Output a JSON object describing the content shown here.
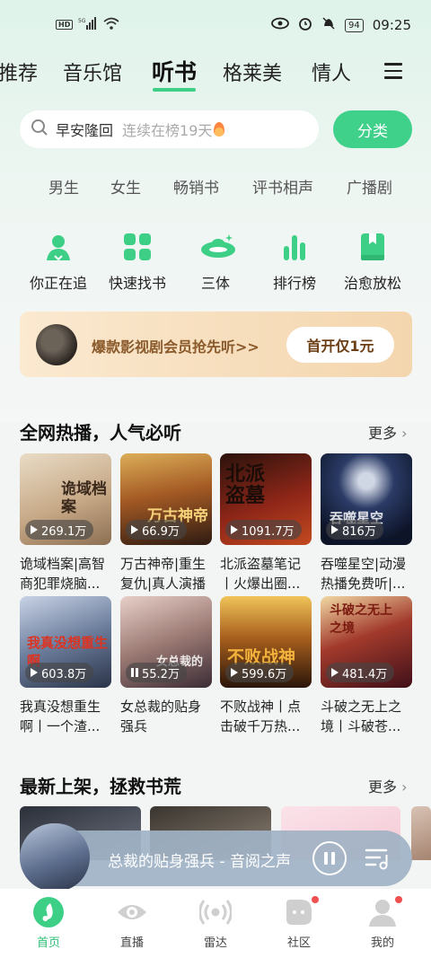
{
  "status_bar": {
    "time": "09:25",
    "battery": "94",
    "hd": "HD",
    "net": "5G"
  },
  "top_tabs": [
    {
      "label": "推荐"
    },
    {
      "label": "音乐馆"
    },
    {
      "label": "听书"
    },
    {
      "label": "格莱美"
    },
    {
      "label": "情人"
    }
  ],
  "search": {
    "keyword": "早安隆回",
    "hint": "连续在榜19天"
  },
  "category_button": "分类",
  "sub_categories": [
    "男生",
    "女生",
    "畅销书",
    "评书相声",
    "广播剧"
  ],
  "quick_entries": [
    {
      "label": "你正在追",
      "icon": "user-listening-icon"
    },
    {
      "label": "快速找书",
      "icon": "grid-icon"
    },
    {
      "label": "三体",
      "icon": "ufo-icon"
    },
    {
      "label": "排行榜",
      "icon": "bar-chart-icon"
    },
    {
      "label": "治愈放松",
      "icon": "book-icon"
    }
  ],
  "banner": {
    "text": "爆款影视剧会员抢先听>>",
    "button": "首开仅1元"
  },
  "section_hot": {
    "title": "全网热播，人气必听",
    "more": "更多",
    "books": [
      {
        "cover_text": "诡域档案",
        "plays": "269.1万",
        "name": "诡域档案|高智商犯罪烧脑..."
      },
      {
        "cover_text": "万古神帝",
        "plays": "66.9万",
        "name": "万古神帝|重生复仇|真人演播"
      },
      {
        "cover_text": "北派盗墓",
        "plays": "1091.7万",
        "name": "北派盗墓笔记丨火爆出圈..."
      },
      {
        "cover_text": "吞噬星空",
        "plays": "816万",
        "name": "吞噬星空|动漫热播免费听|..."
      },
      {
        "cover_text": "我真没想重生啊",
        "plays": "603.8万",
        "name": "我真没想重生啊丨一个渣..."
      },
      {
        "cover_text": "女总裁的",
        "plays": "55.2万",
        "name": "女总裁的贴身强兵"
      },
      {
        "cover_text": "不败战神",
        "plays": "599.6万",
        "name": "不败战神丨点击破千万热..."
      },
      {
        "cover_text": "斗破之无上之境",
        "plays": "481.4万",
        "name": "斗破之无上之境丨斗破苍..."
      }
    ]
  },
  "section_new": {
    "title": "最新上架，拯救书荒",
    "more": "更多"
  },
  "player": {
    "title": "总裁的贴身强兵 - 音阅之声"
  },
  "bottom_nav": [
    {
      "label": "首页"
    },
    {
      "label": "直播"
    },
    {
      "label": "雷达"
    },
    {
      "label": "社区"
    },
    {
      "label": "我的"
    }
  ],
  "colors": {
    "accent": "#3ecf86",
    "banner_text": "#8a5a2b"
  }
}
